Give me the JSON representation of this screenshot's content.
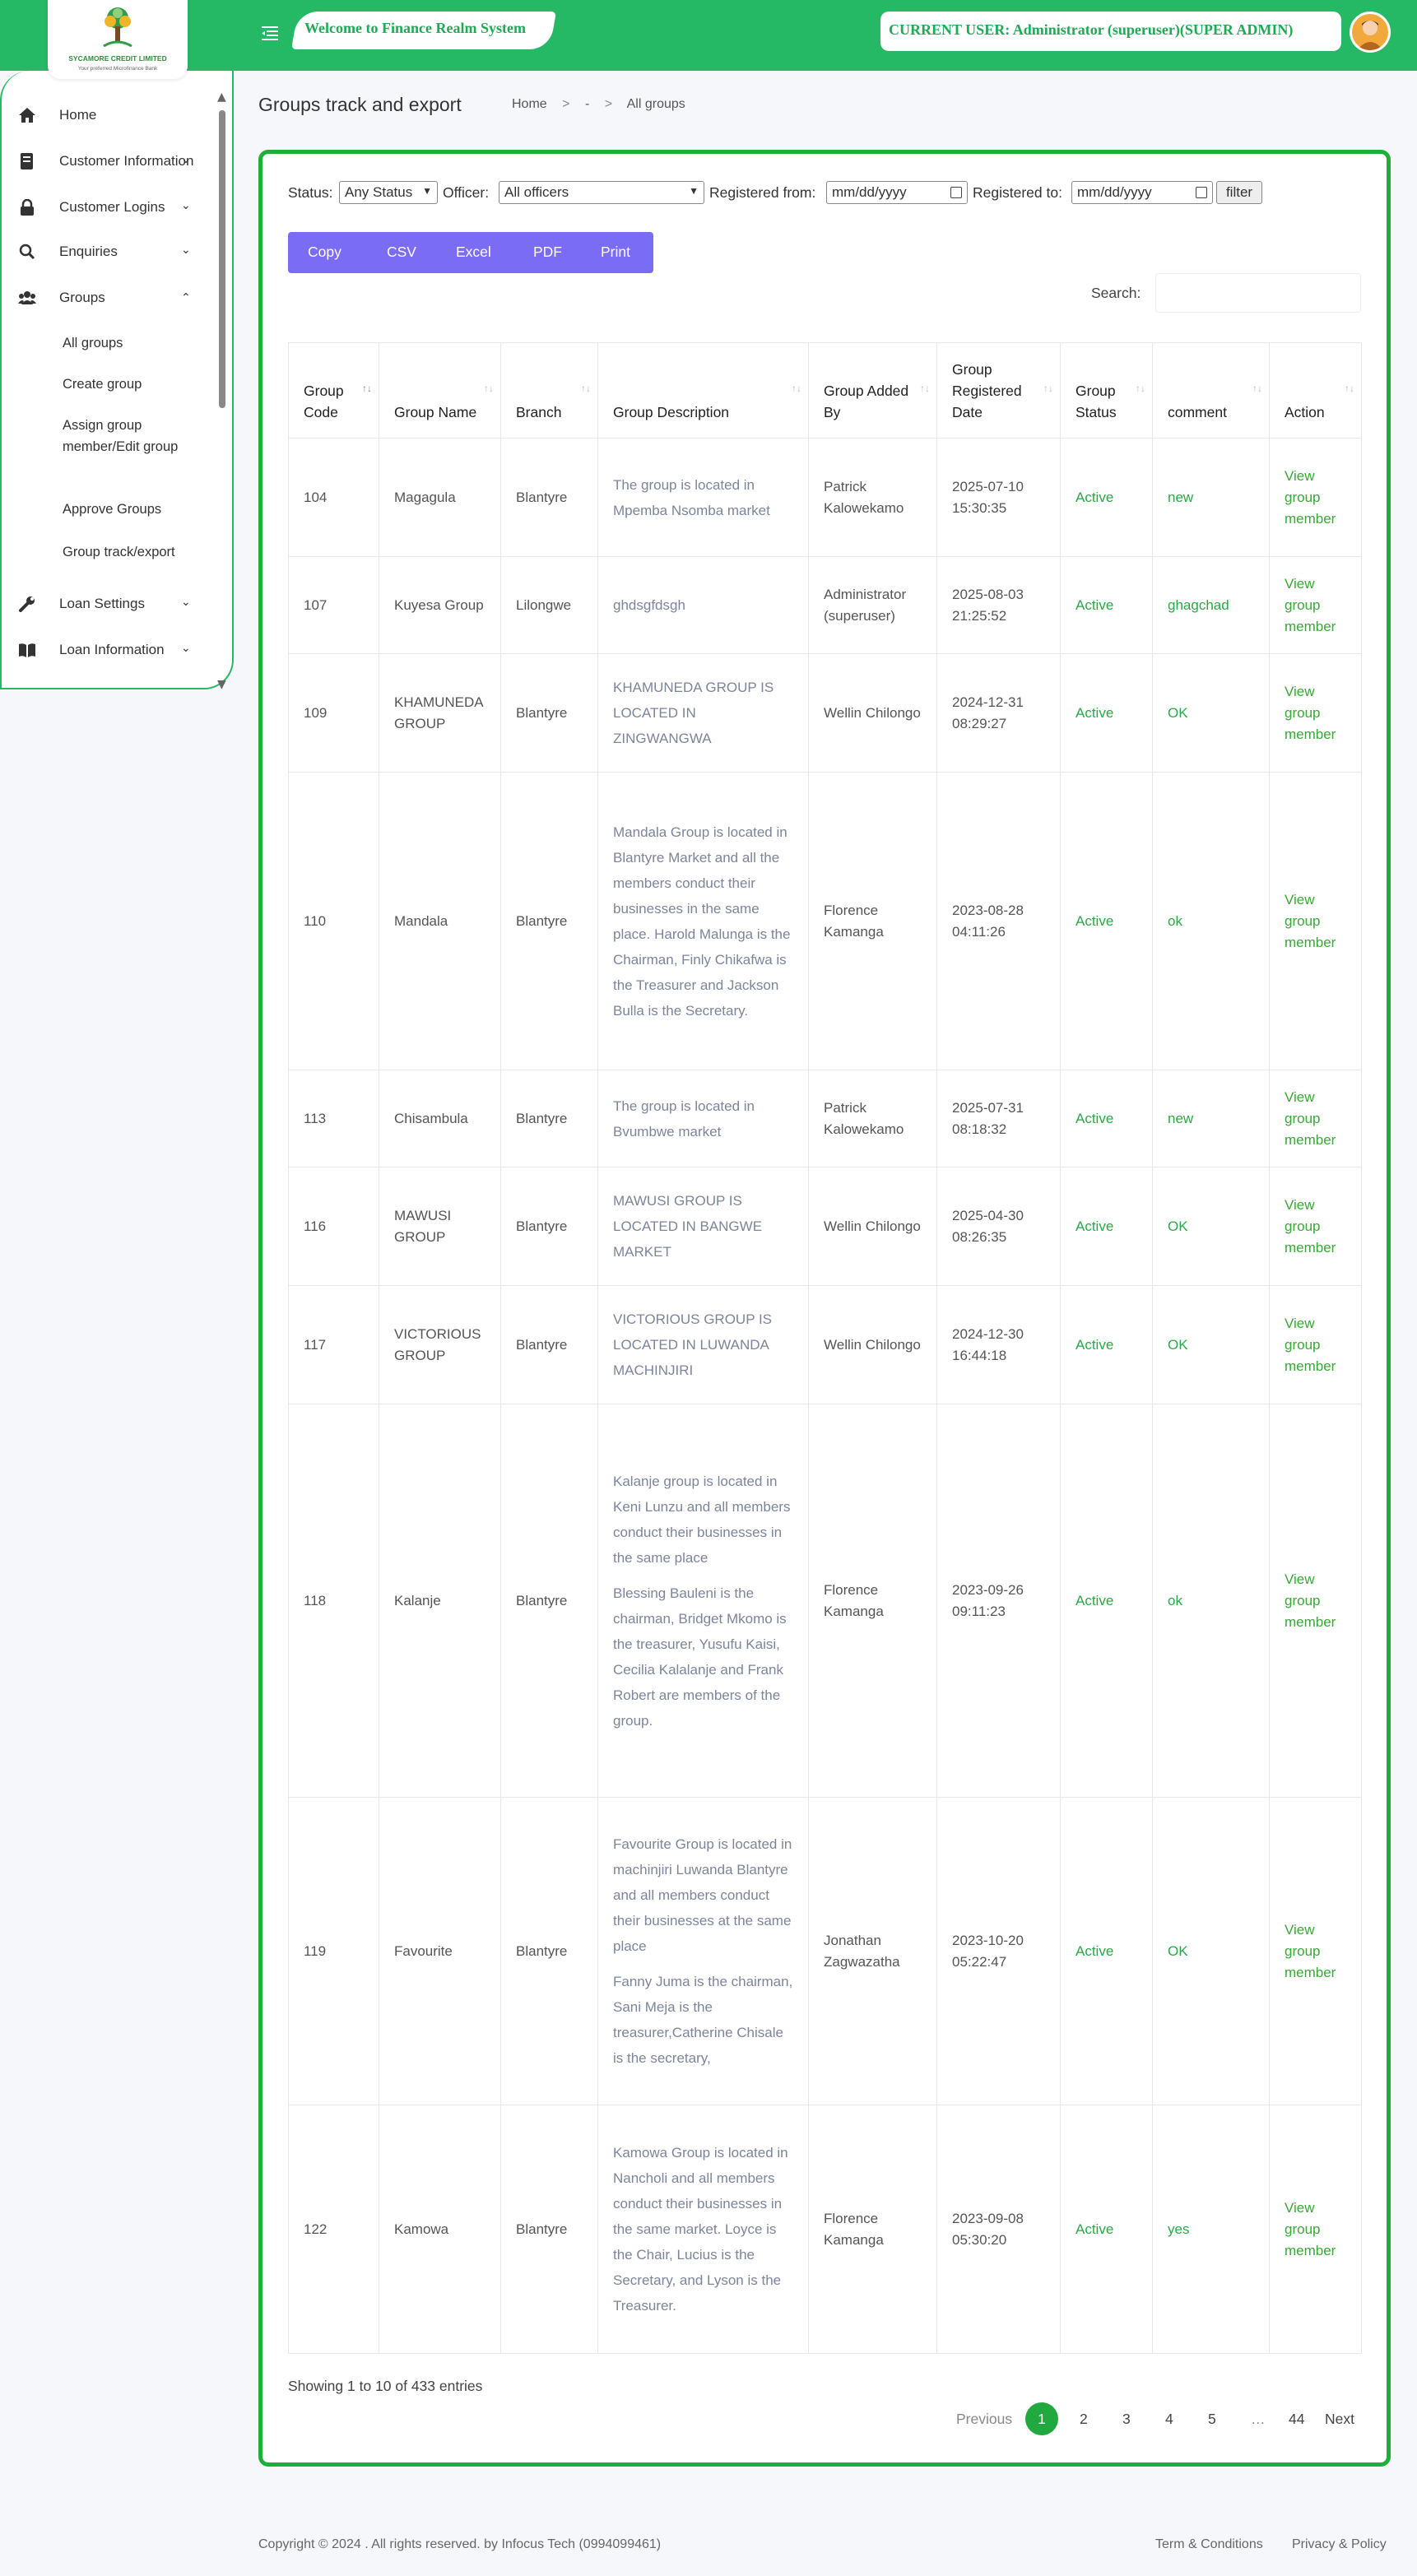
{
  "brand": {
    "logo_name": "SYCAMORE CREDIT LIMITED",
    "logo_tagline": "Your preferred Microfinance Bank"
  },
  "header": {
    "welcome": "Welcome to Finance Realm System",
    "current_user": "CURRENT USER: Administrator (superuser)(SUPER ADMIN)",
    "brand_color": "#25b865"
  },
  "sidebar": {
    "items": [
      {
        "label": "Home",
        "icon": "home-icon"
      },
      {
        "label": "Customer Information",
        "icon": "address-book-icon"
      },
      {
        "label": "Customer Logins",
        "icon": "lock-icon"
      },
      {
        "label": "Enquiries",
        "icon": "search-icon"
      },
      {
        "label": "Groups",
        "icon": "users-icon"
      },
      {
        "label": "Loan Settings",
        "icon": "wrench-icon"
      },
      {
        "label": "Loan Information",
        "icon": "book-icon"
      }
    ],
    "groups_sub": [
      "All groups",
      "Create group",
      "Assign group member/Edit group",
      "Approve Groups",
      "Group track/export"
    ]
  },
  "page": {
    "title": "Groups track and export",
    "breadcrumb": [
      "Home",
      ">",
      "-",
      ">",
      "All groups"
    ]
  },
  "filters": {
    "status_label": "Status:",
    "status_value": "Any Status",
    "officer_label": "Officer:",
    "officer_value": "All officers",
    "from_label": "Registered from:",
    "from_placeholder": "mm/dd/yyyy",
    "to_label": "Registered to:",
    "to_placeholder": "mm/dd/yyyy",
    "filter_button": "filter"
  },
  "export_buttons": [
    "Copy",
    "CSV",
    "Excel",
    "PDF",
    "Print"
  ],
  "search_label": "Search:",
  "table": {
    "headers": [
      "Group Code",
      "Group Name",
      "Branch",
      "Group Description",
      "Group Added By",
      "Group Registered Date",
      "Group Status",
      "comment",
      "Action"
    ],
    "rows": [
      {
        "code": "104",
        "name": "Magagula",
        "branch": "Blantyre",
        "desc": [
          "The group is located in Mpemba Nsomba market"
        ],
        "added_by": "Patrick Kalowekamo",
        "date": "2025-07-10 15:30:35",
        "status": "Active",
        "comment": "new",
        "action": "View group member"
      },
      {
        "code": "107",
        "name": "Kuyesa Group",
        "branch": "Lilongwe",
        "desc": [
          "ghdsgfdsgh"
        ],
        "added_by": "Administrator (superuser)",
        "date": "2025-08-03 21:25:52",
        "status": "Active",
        "comment": "ghagchad",
        "action": "View group member"
      },
      {
        "code": "109",
        "name": "KHAMUNEDA GROUP",
        "branch": "Blantyre",
        "desc": [
          "KHAMUNEDA GROUP IS LOCATED IN ZINGWANGWA"
        ],
        "added_by": "Wellin Chilongo",
        "date": "2024-12-31 08:29:27",
        "status": "Active",
        "comment": "OK",
        "action": "View group member"
      },
      {
        "code": "110",
        "name": "Mandala",
        "branch": "Blantyre",
        "desc": [
          "Mandala Group is located in Blantyre Market and all the members conduct their businesses in the same place. Harold Malunga is the Chairman, Finly Chikafwa is the Treasurer and Jackson Bulla is the Secretary."
        ],
        "added_by": "Florence Kamanga",
        "date": "2023-08-28 04:11:26",
        "status": "Active",
        "comment": "ok",
        "action": "View group member"
      },
      {
        "code": "113",
        "name": "Chisambula",
        "branch": "Blantyre",
        "desc": [
          "The group is located in Bvumbwe market"
        ],
        "added_by": "Patrick Kalowekamo",
        "date": "2025-07-31 08:18:32",
        "status": "Active",
        "comment": "new",
        "action": "View group member"
      },
      {
        "code": "116",
        "name": "MAWUSI GROUP",
        "branch": "Blantyre",
        "desc": [
          "MAWUSI GROUP IS LOCATED IN BANGWE MARKET"
        ],
        "added_by": "Wellin Chilongo",
        "date": "2025-04-30 08:26:35",
        "status": "Active",
        "comment": "OK",
        "action": "View group member"
      },
      {
        "code": "117",
        "name": "VICTORIOUS GROUP",
        "branch": "Blantyre",
        "desc": [
          "VICTORIOUS GROUP IS LOCATED IN LUWANDA MACHINJIRI"
        ],
        "added_by": "Wellin Chilongo",
        "date": "2024-12-30 16:44:18",
        "status": "Active",
        "comment": "OK",
        "action": "View group member"
      },
      {
        "code": "118",
        "name": "Kalanje",
        "branch": "Blantyre",
        "desc": [
          "Kalanje group is located in Keni Lunzu and all members conduct their businesses in the same place",
          "Blessing Bauleni is the chairman, Bridget Mkomo is the treasurer, Yusufu Kaisi, Cecilia Kalalanje and Frank Robert are members of the group."
        ],
        "added_by": "Florence Kamanga",
        "date": "2023-09-26 09:11:23",
        "status": "Active",
        "comment": "ok",
        "action": "View group member"
      },
      {
        "code": "119",
        "name": "Favourite",
        "branch": "Blantyre",
        "desc": [
          "Favourite Group is located in machinjiri Luwanda Blantyre  and all members conduct their businesses at the same place",
          "Fanny Juma is the chairman, Sani Meja is the treasurer,Catherine Chisale is the secretary,"
        ],
        "added_by": "Jonathan Zagwazatha",
        "date": "2023-10-20 05:22:47",
        "status": "Active",
        "comment": "OK",
        "action": "View group member"
      },
      {
        "code": "122",
        "name": "Kamowa",
        "branch": "Blantyre",
        "desc": [
          "Kamowa Group is located in Nancholi and all members conduct their businesses in the same market. Loyce is the Chair, Lucius is the Secretary, and Lyson is the Treasurer."
        ],
        "added_by": "Florence Kamanga",
        "date": "2023-09-08 05:30:20",
        "status": "Active",
        "comment": "yes",
        "action": "View group member"
      }
    ]
  },
  "entries_info": "Showing 1 to 10 of 433 entries",
  "pagination": {
    "previous": "Previous",
    "pages": [
      "1",
      "2",
      "3",
      "4",
      "5",
      "…",
      "44"
    ],
    "next": "Next",
    "active_page": "1"
  },
  "footer": {
    "copyright": "Copyright © 2024 . All rights reserved. by Infocus Tech (0994099461)",
    "terms": "Term & Conditions",
    "privacy": "Privacy & Policy"
  }
}
